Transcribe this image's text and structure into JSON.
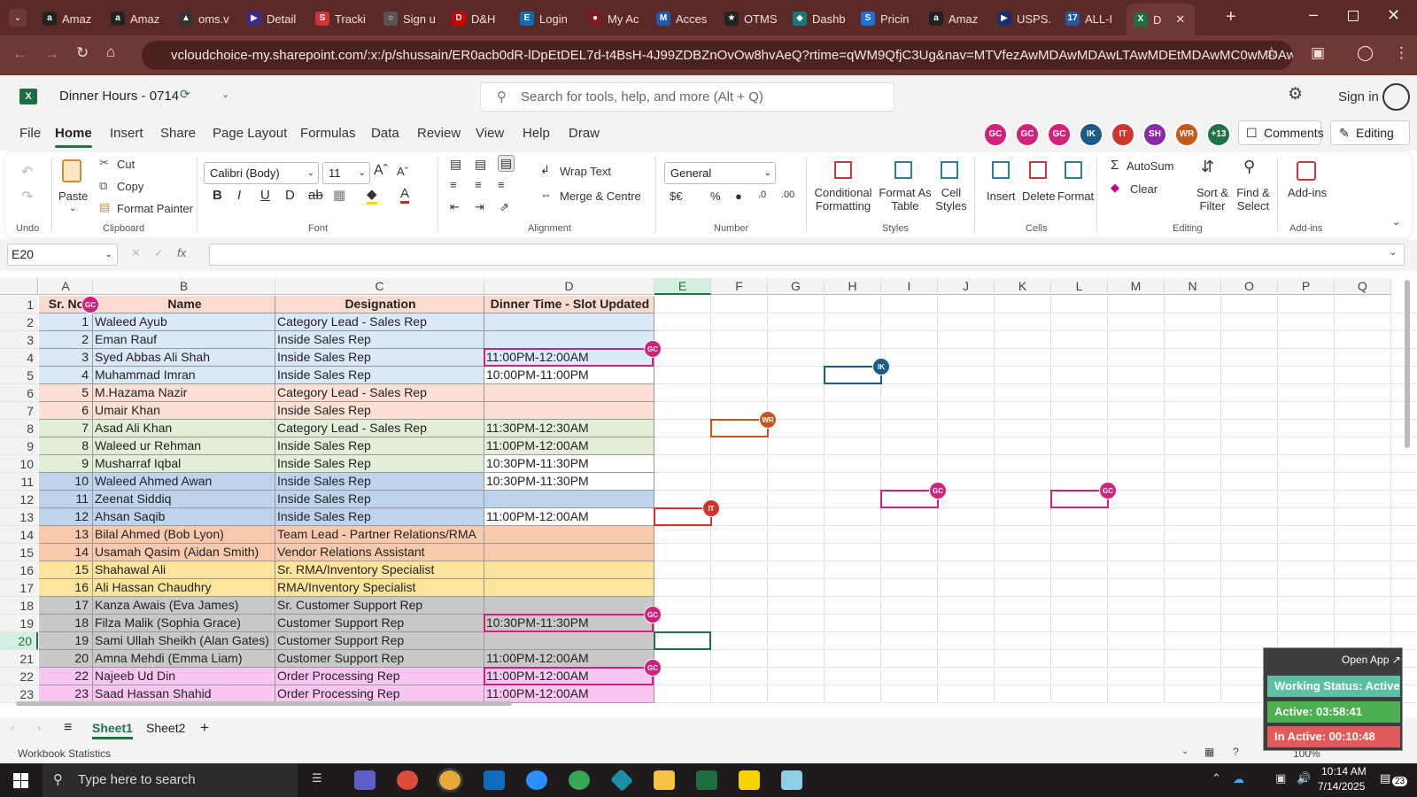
{
  "browser": {
    "tabs": [
      "Amaz",
      "Amaz",
      "oms.v",
      "Detail",
      "Tracki",
      "Sign u",
      "D&H",
      "Login",
      "My Ac",
      "Acces",
      "OTMS",
      "Dashb",
      "Pricin",
      "Amaz",
      "USPS.",
      "ALL-I",
      "D"
    ],
    "url": "vcloudchoice-my.sharepoint.com/:x:/p/shussain/ER0acb0dR-lDpEtDEL7d-t4BsH-4J99ZDBZnOvOw8hvAeQ?rtime=qWM9QfjC3Ug&nav=MTVfezAwMDAwMDAwLTAwMDEtMDAwMC0wMDAwLTAwM..."
  },
  "excel": {
    "doc_title": "Dinner Hours - 0714",
    "search_placeholder": "Search for tools, help, and more (Alt + Q)",
    "sign_in": "Sign in",
    "menu": [
      "File",
      "Home",
      "Insert",
      "Share",
      "Page Layout",
      "Formulas",
      "Data",
      "Review",
      "View",
      "Help",
      "Draw"
    ],
    "avatars": [
      {
        "initials": "GC",
        "color": "#d1217a"
      },
      {
        "initials": "GC",
        "color": "#d1217a"
      },
      {
        "initials": "GC",
        "color": "#d1217a"
      },
      {
        "initials": "IK",
        "color": "#1e5a8a"
      },
      {
        "initials": "IT",
        "color": "#d1342f"
      },
      {
        "initials": "SH",
        "color": "#8b2aa5"
      },
      {
        "initials": "WR",
        "color": "#c8561a"
      },
      {
        "initials": "+13",
        "color": "#217346"
      }
    ],
    "comments": "Comments",
    "editing": "Editing",
    "ribbon": {
      "paste": "Paste",
      "cut": "Cut",
      "copy": "Copy",
      "format_painter": "Format Painter",
      "undo_group": "Undo",
      "clipboard_group": "Clipboard",
      "font_name": "Calibri (Body)",
      "font_size": "11",
      "font_group": "Font",
      "wrap_text": "Wrap Text",
      "merge_centre": "Merge & Centre",
      "alignment_group": "Alignment",
      "number_format": "General",
      "number_group": "Number",
      "conditional_formatting": "Conditional Formatting",
      "format_as_table": "Format As Table",
      "cell_styles": "Cell Styles",
      "styles_group": "Styles",
      "insert": "Insert",
      "delete": "Delete",
      "format": "Format",
      "cells_group": "Cells",
      "autosum": "AutoSum",
      "clear": "Clear",
      "sort_filter": "Sort & Filter",
      "find_select": "Find & Select",
      "editing_group": "Editing",
      "addins": "Add-ins",
      "addins_group": "Add-ins"
    },
    "name_box": "E20",
    "columns": [
      "A",
      "B",
      "C",
      "D",
      "E",
      "F",
      "G",
      "H",
      "I",
      "J",
      "K",
      "L",
      "M",
      "N",
      "O",
      "P",
      "Q"
    ],
    "headers": [
      "Sr. No",
      "Name",
      "Designation",
      "Dinner Time - Slot Updated"
    ],
    "rows": [
      {
        "n": "1",
        "name": "Waleed Ayub",
        "des": "Category Lead - Sales Rep",
        "time": "",
        "bg": "#dbe8f7"
      },
      {
        "n": "2",
        "name": "Eman Rauf",
        "des": "Inside Sales Rep",
        "time": "",
        "bg": "#dbe8f7"
      },
      {
        "n": "3",
        "name": "Syed Abbas Ali Shah",
        "des": "Inside Sales Rep",
        "time": "11:00PM-12:00AM",
        "bg": "#dbe8f7"
      },
      {
        "n": "4",
        "name": "Muhammad Imran",
        "des": "Inside Sales Rep",
        "time": "10:00PM-11:00PM",
        "bg": "#dbe8f7"
      },
      {
        "n": "5",
        "name": "M.Hazama Nazir",
        "des": "Category Lead - Sales Rep",
        "time": "",
        "bg": "#fce0d6"
      },
      {
        "n": "6",
        "name": "Umair Khan",
        "des": "Inside Sales Rep",
        "time": "",
        "bg": "#fce0d6"
      },
      {
        "n": "7",
        "name": "Asad Ali Khan",
        "des": "Category Lead - Sales Rep",
        "time": "11:30PM-12:30AM",
        "bg": "#e1efd9"
      },
      {
        "n": "8",
        "name": "Waleed ur Rehman",
        "des": "Inside Sales Rep",
        "time": "11:00PM-12:00AM",
        "bg": "#e1efd9"
      },
      {
        "n": "9",
        "name": "Musharraf Iqbal",
        "des": "Inside Sales Rep",
        "time": "10:30PM-11:30PM",
        "bg": "#e1efd9"
      },
      {
        "n": "10",
        "name": "Waleed Ahmed Awan",
        "des": "Inside Sales Rep",
        "time": "10:30PM-11:30PM",
        "bg": "#bcd5ec"
      },
      {
        "n": "11",
        "name": "Zeenat Siddiq",
        "des": "Inside Sales Rep",
        "time": "",
        "bg": "#bcd5ec"
      },
      {
        "n": "12",
        "name": "Ahsan Saqib",
        "des": "Inside Sales Rep",
        "time": "11:00PM-12:00AM",
        "bg": "#bcd5ec"
      },
      {
        "n": "13",
        "name": "Bilal Ahmed (Bob Lyon)",
        "des": "Team Lead - Partner Relations/RMA",
        "time": "",
        "bg": "#f9c9ad"
      },
      {
        "n": "14",
        "name": "Usamah Qasim (Aidan Smith)",
        "des": "Vendor Relations Assistant",
        "time": "",
        "bg": "#f9c9ad"
      },
      {
        "n": "15",
        "name": "Shahawal Ali",
        "des": "Sr. RMA/Inventory Specialist",
        "time": "",
        "bg": "#fde49a"
      },
      {
        "n": "16",
        "name": "Ali Hassan Chaudhry",
        "des": "RMA/Inventory Specialist",
        "time": "",
        "bg": "#fde49a"
      },
      {
        "n": "17",
        "name": "Kanza Awais (Eva James)",
        "des": "Sr. Customer Support Rep",
        "time": "",
        "bg": "#c8c8c8"
      },
      {
        "n": "18",
        "name": "Filza Malik (Sophia Grace)",
        "des": "Customer Support Rep",
        "time": "10:30PM-11:30PM",
        "bg": "#c8c8c8"
      },
      {
        "n": "19",
        "name": "Sami Ullah Sheikh (Alan Gates)",
        "des": "Customer Support Rep",
        "time": "",
        "bg": "#c8c8c8"
      },
      {
        "n": "20",
        "name": "Amna Mehdi (Emma Liam)",
        "des": "Customer Support Rep",
        "time": "11:00PM-12:00AM",
        "bg": "#c8c8c8"
      },
      {
        "n": "22",
        "name": "Najeeb Ud Din",
        "des": "Order Processing Rep",
        "time": "11:00PM-12:00AM",
        "bg": "#f9c6f3"
      },
      {
        "n": "23",
        "name": "Saad Hassan Shahid",
        "des": "Order Processing Rep",
        "time": "11:00PM-12:00AM",
        "bg": "#f9c6f3"
      }
    ],
    "presence": {
      "gc": "GC",
      "ik": "IK",
      "wr": "WR",
      "it": "IT"
    },
    "sheets": [
      "Sheet1",
      "Sheet2"
    ],
    "status_text": "Workbook Statistics",
    "zoom": "100%"
  },
  "widget": {
    "open_app": "Open App ↗",
    "working": "Working Status: Active",
    "active": "Active: 03:58:41",
    "inactive": "In Active: 00:10:48"
  },
  "taskbar": {
    "search": "Type here to search",
    "time": "10:14 AM",
    "date": "7/14/2025",
    "notif": "23"
  }
}
